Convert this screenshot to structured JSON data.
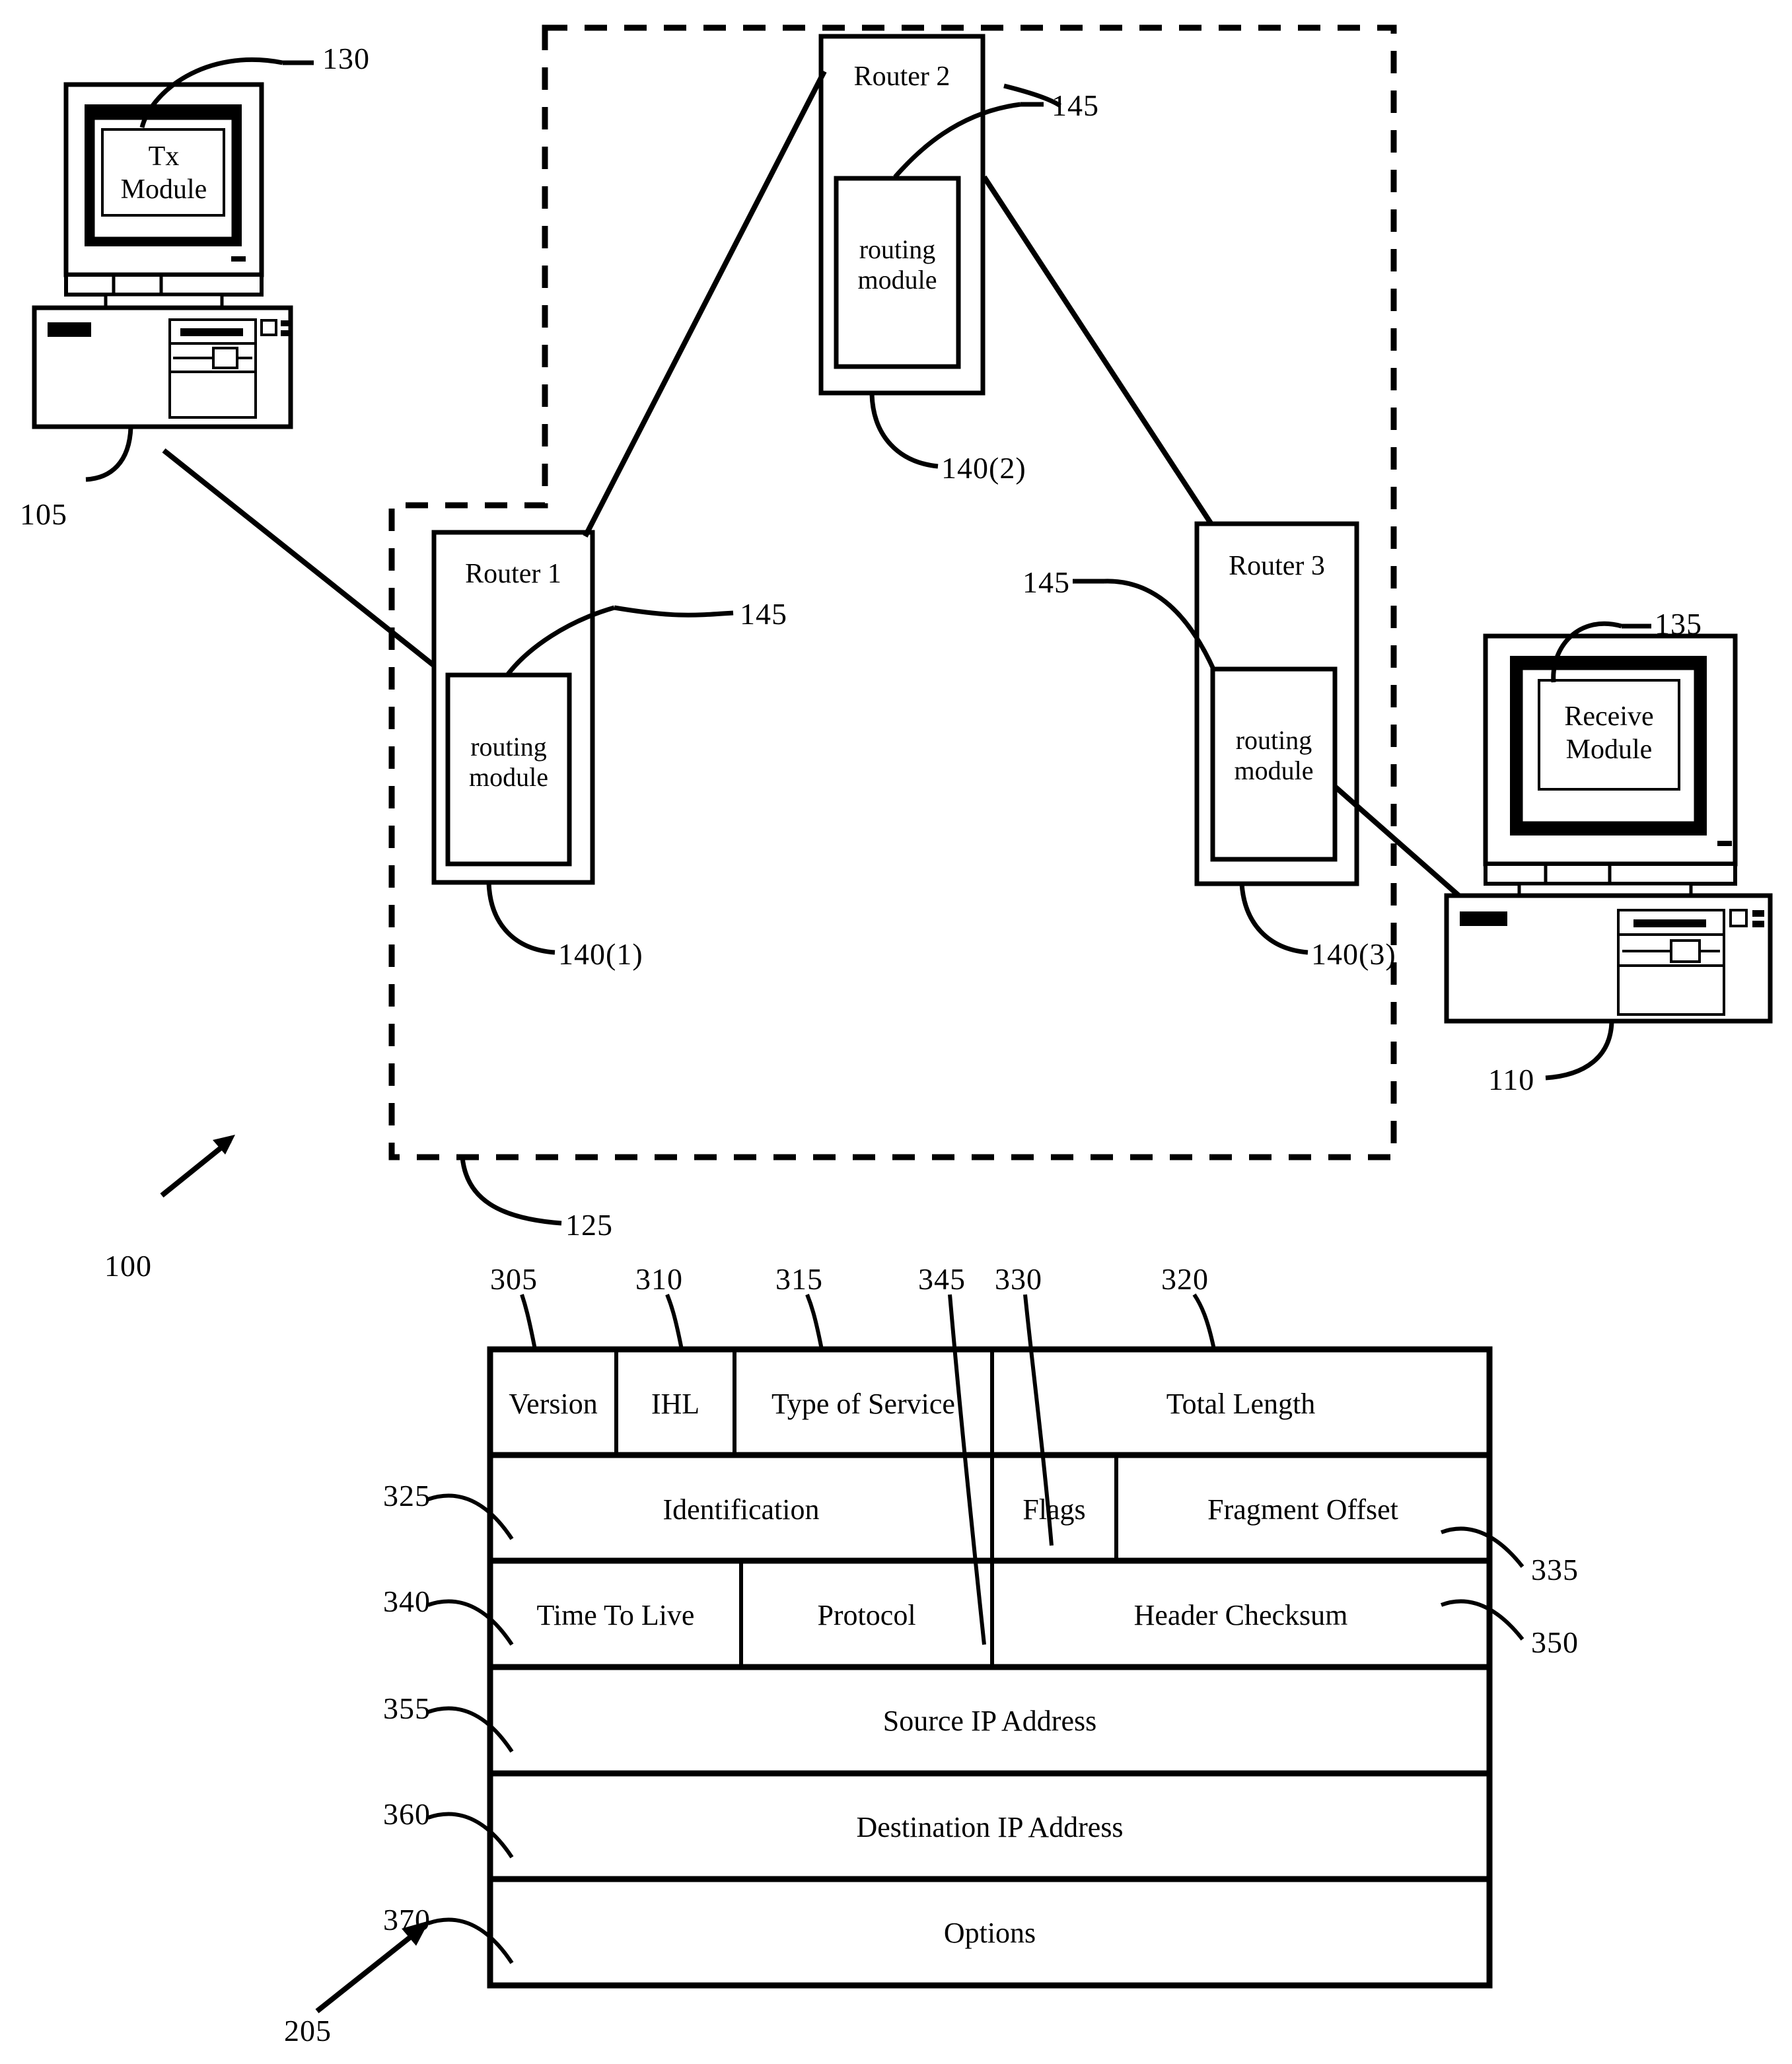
{
  "figure": {
    "system_ref": "100",
    "packet_ref": "205"
  },
  "network": {
    "ref": "125"
  },
  "tx_computer": {
    "ref": "105",
    "module_ref": "130",
    "module_label_line1": "Tx",
    "module_label_line2": "Module"
  },
  "rx_computer": {
    "ref": "110",
    "module_ref": "135",
    "module_label_line1": "Receive",
    "module_label_line2": "Module"
  },
  "routers": [
    {
      "title": "Router 1",
      "module_label_line1": "routing",
      "module_label_line2": "module",
      "module_ref": "140(1)",
      "callout_ref": "145"
    },
    {
      "title": "Router 2",
      "module_label_line1": "routing",
      "module_label_line2": "module",
      "module_ref": "140(2)",
      "callout_ref": "145"
    },
    {
      "title": "Router 3",
      "module_label_line1": "routing",
      "module_label_line2": "module",
      "module_ref": "140(3)",
      "callout_ref": "145"
    }
  ],
  "ip_header": {
    "rows": [
      {
        "cells": [
          {
            "label": "Version",
            "ref": "305"
          },
          {
            "label": "IHL",
            "ref": "310"
          },
          {
            "label": "Type of Service",
            "ref": "315"
          },
          {
            "label": "Total Length",
            "ref": "320"
          }
        ]
      },
      {
        "cells": [
          {
            "label": "Identification",
            "ref": "325"
          },
          {
            "label": "Flags",
            "ref": "330"
          },
          {
            "label": "Fragment Offset",
            "ref": "335"
          }
        ]
      },
      {
        "cells": [
          {
            "label": "Time To Live",
            "ref": "340"
          },
          {
            "label": "Protocol",
            "ref": "345"
          },
          {
            "label": "Header Checksum",
            "ref": "350"
          }
        ]
      },
      {
        "cells": [
          {
            "label": "Source IP Address",
            "ref": "355"
          }
        ]
      },
      {
        "cells": [
          {
            "label": "Destination IP Address",
            "ref": "360"
          }
        ]
      },
      {
        "cells": [
          {
            "label": "Options",
            "ref": "370"
          }
        ]
      }
    ]
  },
  "colors": {
    "ink": "#000000",
    "paper": "#ffffff"
  }
}
